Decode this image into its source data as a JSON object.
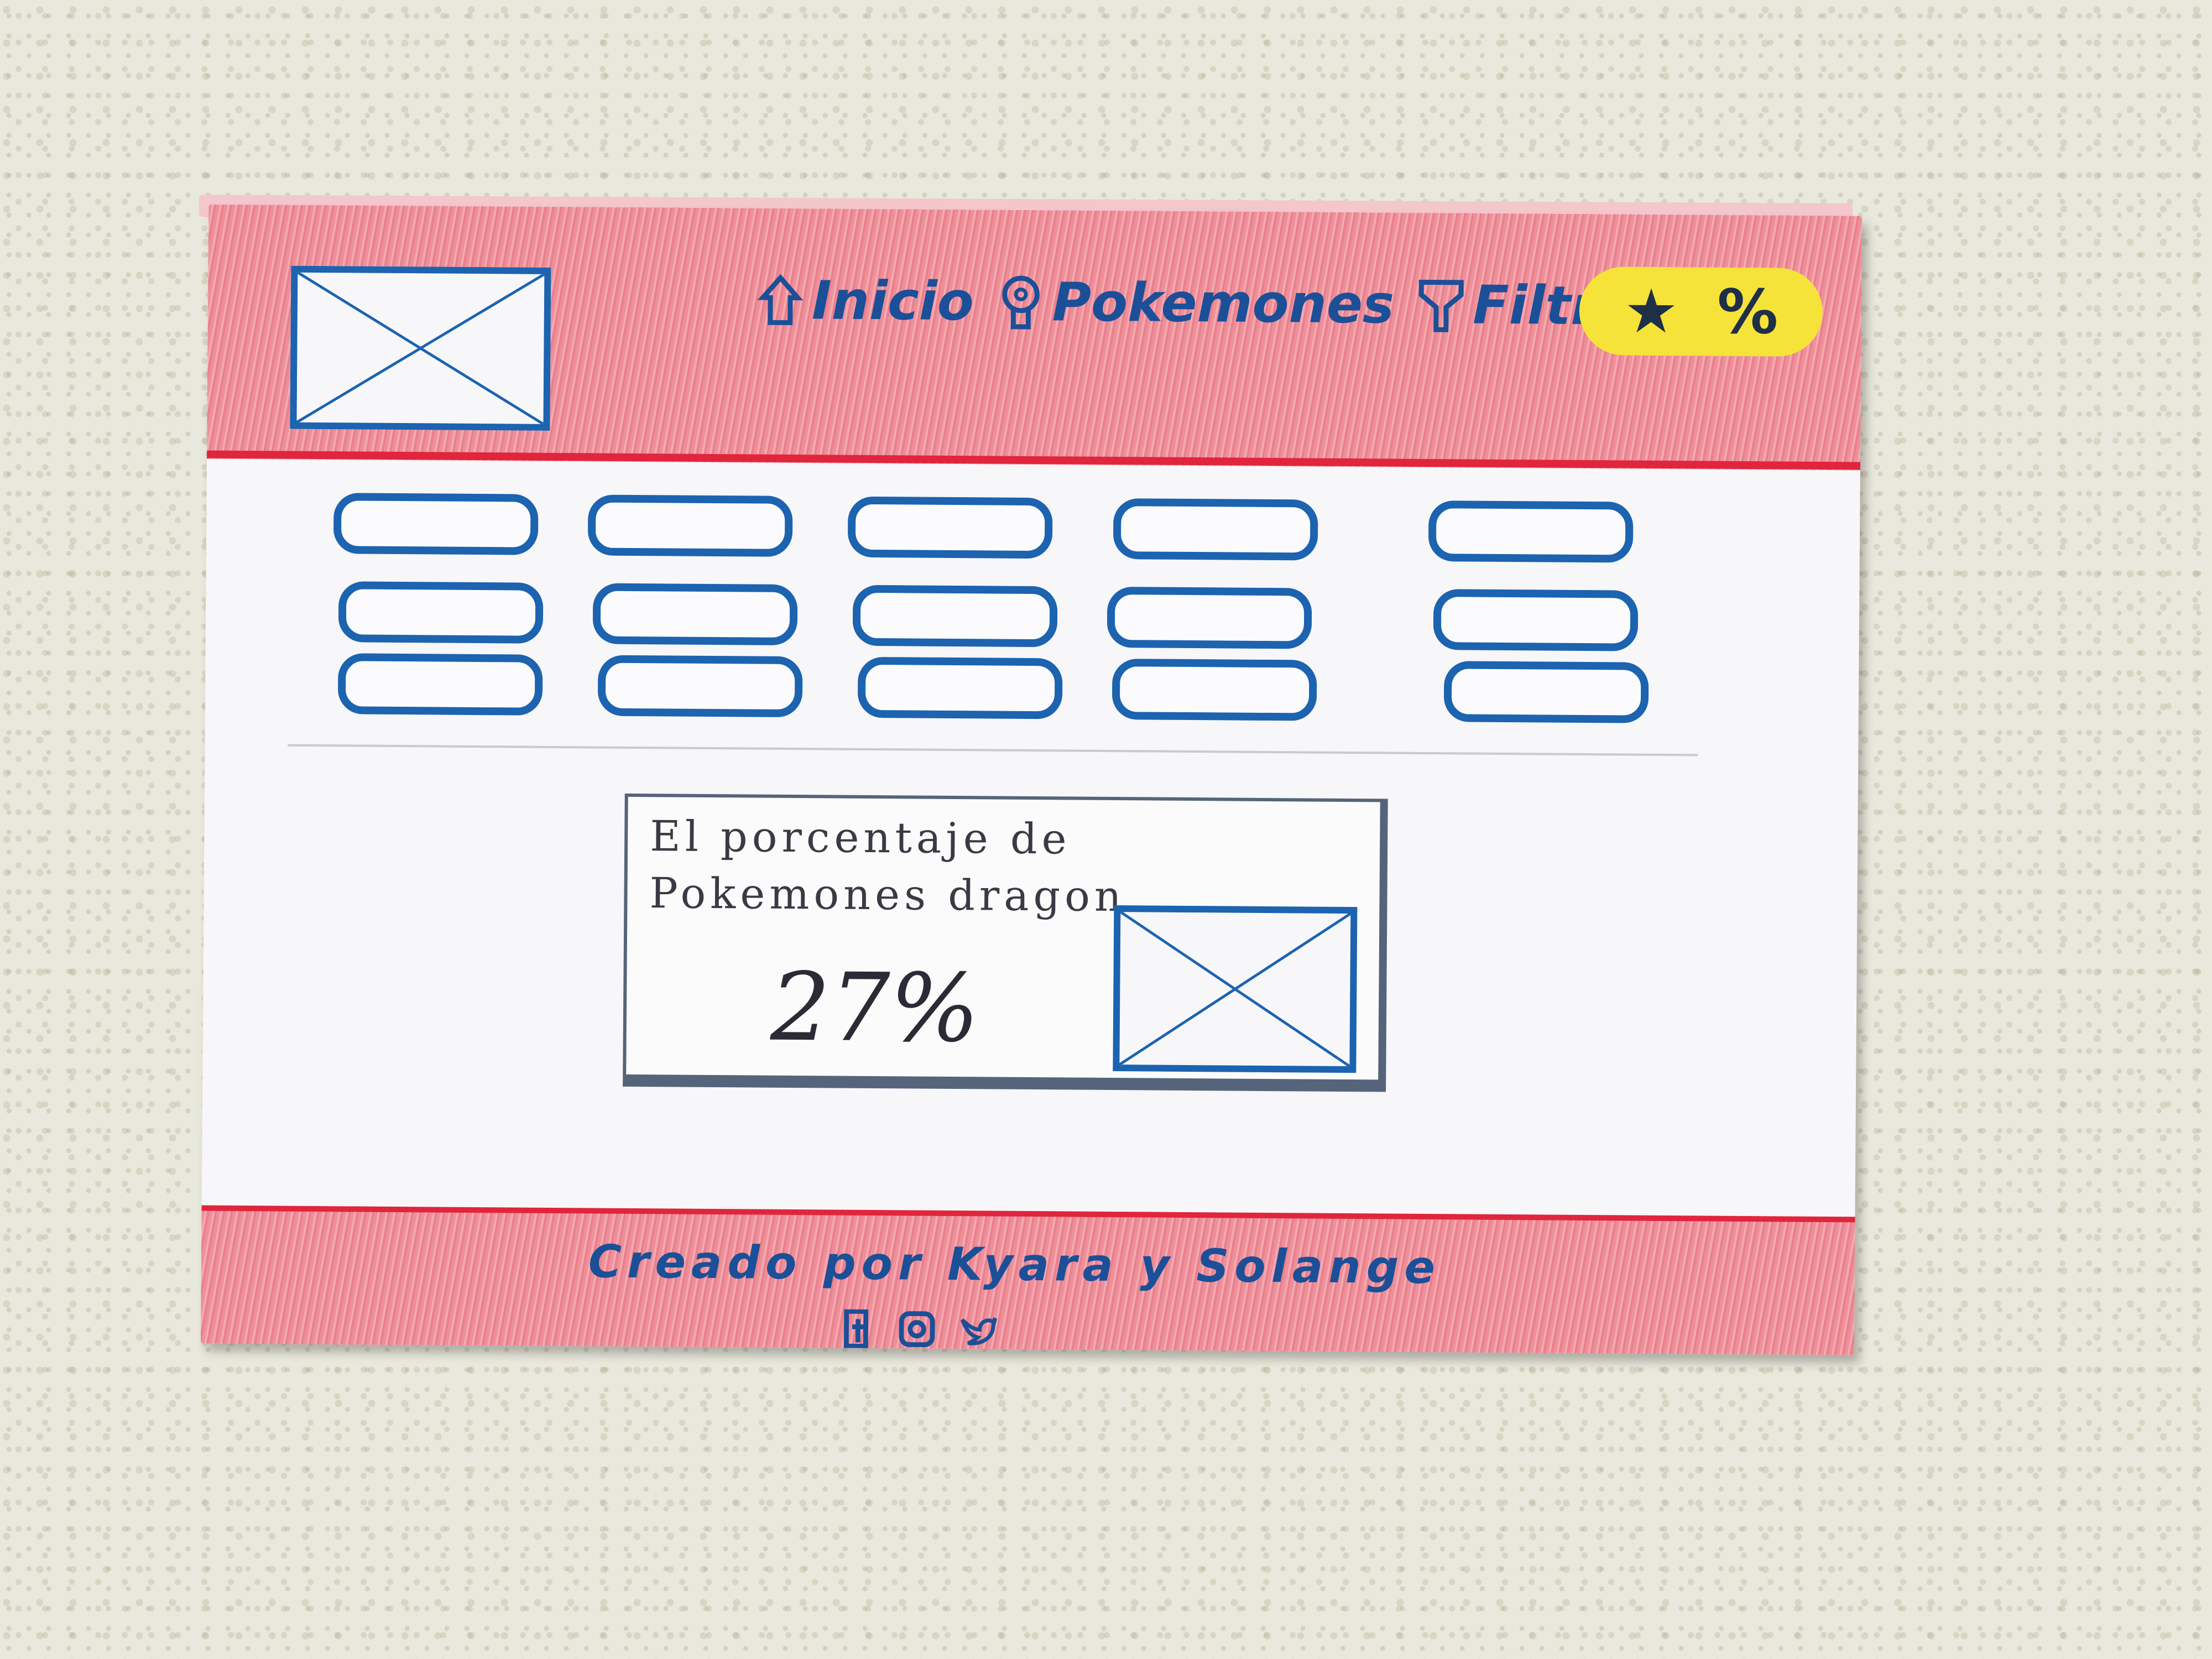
{
  "nav": {
    "items": [
      {
        "label": "Inicio",
        "icon": "home-icon"
      },
      {
        "label": "Pokemones",
        "icon": "pokeball-pin-icon"
      },
      {
        "label": "Filtrar",
        "icon": "filter-icon"
      }
    ],
    "percent_button": {
      "star": "★",
      "label": "%"
    }
  },
  "stat": {
    "text": "El porcentaje de Pokemones dragon",
    "value": "27%"
  },
  "footer": {
    "credit": "Creado por Kyara y Solange",
    "socials": [
      "facebook-icon",
      "instagram-icon",
      "twitter-icon"
    ]
  },
  "colors": {
    "header_red": "#ee8f99",
    "accent_line": "#e0253c",
    "wire_blue": "#1c63b0",
    "pill_yellow": "#f6e33a"
  }
}
